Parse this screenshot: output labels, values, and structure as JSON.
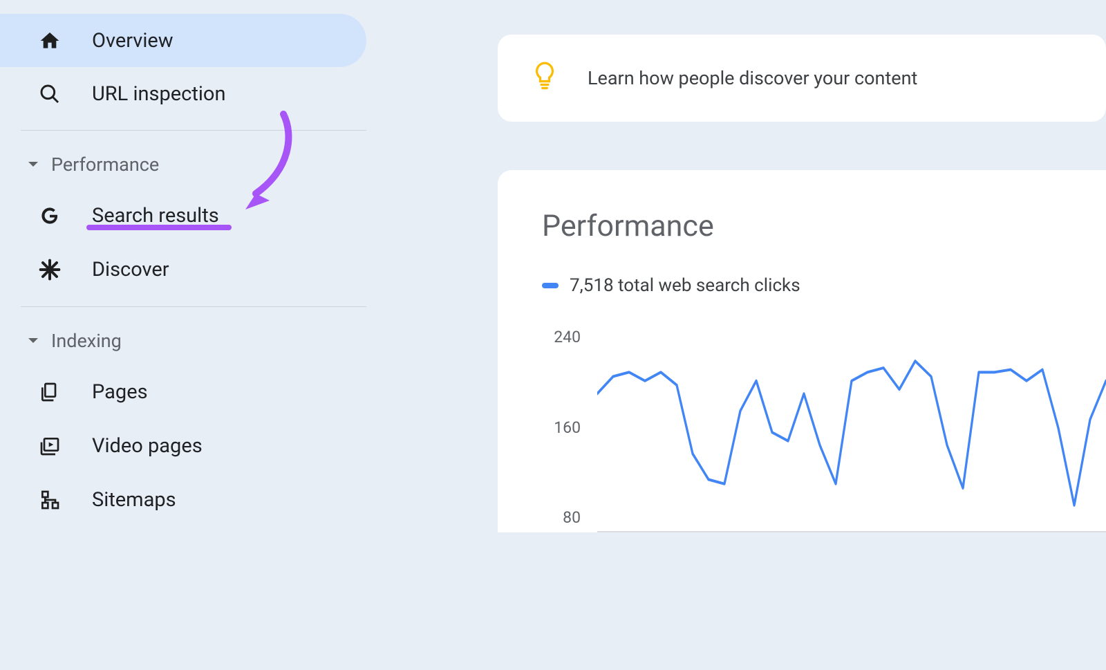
{
  "sidebar": {
    "overview": "Overview",
    "url_inspection": "URL inspection",
    "sections": {
      "performance": {
        "label": "Performance",
        "items": {
          "search_results": "Search results",
          "discover": "Discover"
        }
      },
      "indexing": {
        "label": "Indexing",
        "items": {
          "pages": "Pages",
          "video_pages": "Video pages",
          "sitemaps": "Sitemaps"
        }
      }
    }
  },
  "tip": {
    "text": "Learn how people discover your content"
  },
  "performance": {
    "title": "Performance",
    "legend": "7,518 total web search clicks"
  },
  "chart_data": {
    "type": "line",
    "title": "Performance",
    "ylabel": "",
    "xlabel": "",
    "ylim": [
      40,
      280
    ],
    "y_ticks": [
      240,
      160,
      80
    ],
    "series": [
      {
        "name": "Web search clicks",
        "values": [
          200,
          220,
          225,
          215,
          225,
          210,
          130,
          100,
          95,
          180,
          215,
          155,
          145,
          200,
          140,
          95,
          215,
          225,
          230,
          205,
          238,
          220,
          140,
          90,
          225,
          225,
          228,
          215,
          228,
          160,
          70,
          170,
          215
        ]
      }
    ]
  },
  "annotation": {
    "color": "#a855f7"
  }
}
